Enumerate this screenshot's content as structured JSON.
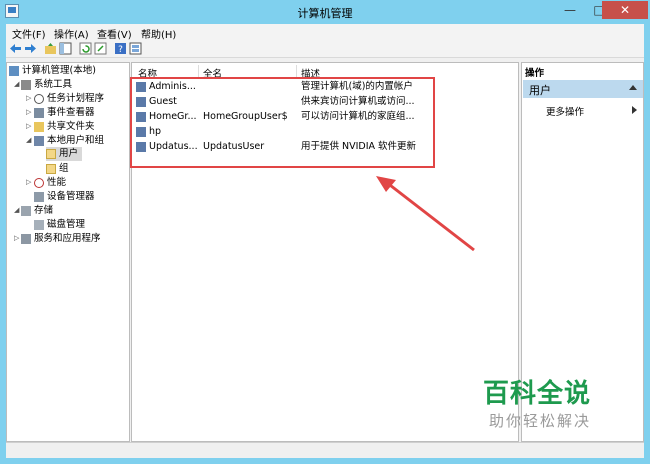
{
  "window": {
    "title": "计算机管理",
    "min": "—",
    "max": "□",
    "close": "✕"
  },
  "menubar": [
    "文件(F)",
    "操作(A)",
    "查看(V)",
    "帮助(H)"
  ],
  "toolbar_icons": [
    "back-arrow-icon",
    "forward-arrow-icon",
    "up-folder-icon",
    "show-hide-tree-icon",
    "refresh-icon",
    "export-list-icon",
    "help-icon",
    "properties-icon"
  ],
  "tree": {
    "root": "计算机管理(本地)",
    "system_tools": "系统工具",
    "task_scheduler": "任务计划程序",
    "event_viewer": "事件查看器",
    "shared_folders": "共享文件夹",
    "local_users_groups": "本地用户和组",
    "users": "用户",
    "groups": "组",
    "performance": "性能",
    "device_manager": "设备管理器",
    "storage": "存储",
    "disk_management": "磁盘管理",
    "services_apps": "服务和应用程序"
  },
  "list": {
    "columns": {
      "name": "名称",
      "fullname": "全名",
      "description": "描述"
    },
    "rows": [
      {
        "name": "Adminis...",
        "fullname": "",
        "description": "管理计算机(域)的内置帐户"
      },
      {
        "name": "Guest",
        "fullname": "",
        "description": "供来宾访问计算机或访问..."
      },
      {
        "name": "HomeGr...",
        "fullname": "HomeGroupUser$",
        "description": "可以访问计算机的家庭组..."
      },
      {
        "name": "hp",
        "fullname": "",
        "description": ""
      },
      {
        "name": "Updatus...",
        "fullname": "UpdatusUser",
        "description": "用于提供 NVIDIA 软件更新"
      }
    ]
  },
  "actions": {
    "header": "操作",
    "selected": "用户",
    "more": "更多操作"
  },
  "watermark": {
    "title": "百科全说",
    "subtitle": "助你轻松解决"
  },
  "colors": {
    "titlebar": "#7fd0ee",
    "close": "#c7504a",
    "highlight": "#e14545",
    "watermark": "#1e9a4e"
  }
}
